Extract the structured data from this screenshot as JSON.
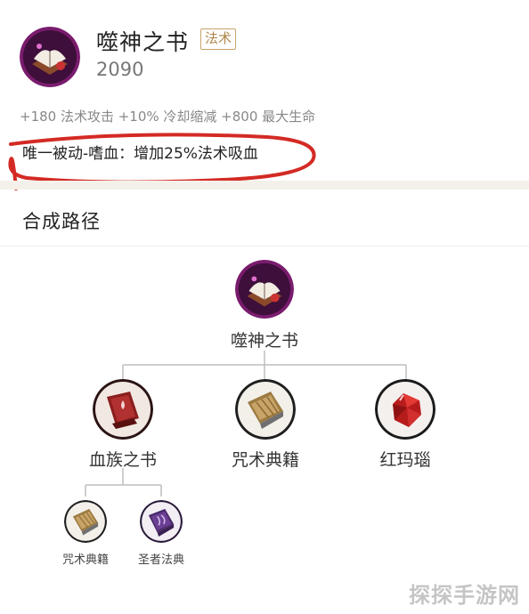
{
  "item": {
    "name": "噬神之书",
    "tag": "法术",
    "price": "2090",
    "stats": "+180 法术攻击 +10% 冷却缩减 +800 最大生命",
    "passive": "唯一被动-嗜血：增加25%法术吸血",
    "icon": "book-of-devouring-icon"
  },
  "recipe": {
    "title": "合成路径",
    "root": {
      "label": "噬神之书",
      "icon": "book-of-devouring-icon"
    },
    "components": [
      {
        "label": "血族之书",
        "icon": "blood-book-icon"
      },
      {
        "label": "咒术典籍",
        "icon": "spell-tome-icon"
      },
      {
        "label": "红玛瑙",
        "icon": "red-agate-icon"
      }
    ],
    "sub_components": [
      {
        "label": "咒术典籍",
        "icon": "spell-tome-icon"
      },
      {
        "label": "圣者法典",
        "icon": "saint-codex-icon"
      }
    ]
  },
  "watermark": "探探手游网",
  "colors": {
    "accent_gold": "#c8a36a",
    "annotation_red": "#d42a24",
    "line_gray": "#bdbdbd"
  }
}
